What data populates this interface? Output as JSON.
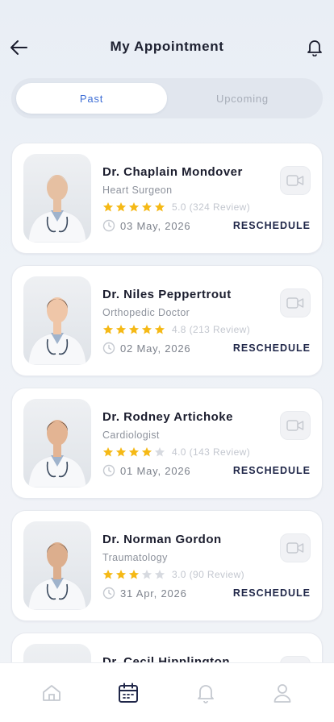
{
  "header": {
    "title": "My Appointment"
  },
  "tabs": [
    {
      "label": "Past",
      "active": true
    },
    {
      "label": "Upcoming",
      "active": false
    }
  ],
  "appointments": [
    {
      "name": "Dr. Chaplain Mondover",
      "specialty": "Heart Surgeon",
      "rating": "5.0",
      "stars": 5,
      "reviews": "(324 Review)",
      "date": "03 May, 2026",
      "action": "RESCHEDULE"
    },
    {
      "name": "Dr. Niles Peppertrout",
      "specialty": "Orthopedic Doctor",
      "rating": "4.8",
      "stars": 5,
      "reviews": "(213 Review)",
      "date": "02 May, 2026",
      "action": "RESCHEDULE"
    },
    {
      "name": "Dr. Rodney Artichoke",
      "specialty": "Cardiologist",
      "rating": "4.0",
      "stars": 4,
      "reviews": "(143 Review)",
      "date": "01 May, 2026",
      "action": "RESCHEDULE"
    },
    {
      "name": "Dr. Norman Gordon",
      "specialty": "Traumatology",
      "rating": "3.0",
      "stars": 3,
      "reviews": "(90 Review)",
      "date": "31 Apr, 2026",
      "action": "RESCHEDULE"
    },
    {
      "name": "Dr. Cecil Hipplington",
      "specialty": "",
      "rating": "",
      "stars": 0,
      "reviews": "",
      "date": "",
      "action": ""
    }
  ],
  "icons": {
    "back": "arrow-left-icon",
    "notification": "bell-icon",
    "video": "video-camera-icon",
    "star": "star-icon",
    "clock": "clock-icon",
    "nav": [
      "home-icon",
      "calendar-icon",
      "bell-icon",
      "profile-icon"
    ]
  },
  "colors": {
    "accent": "#3f6fd6",
    "star_filled": "#f5b916",
    "star_empty": "#d7dae0",
    "action": "#1f2648"
  },
  "bottom_nav": {
    "active_index": 1
  }
}
